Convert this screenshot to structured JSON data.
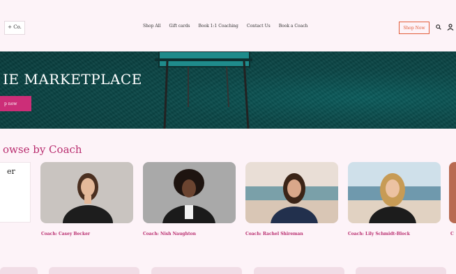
{
  "header": {
    "logo_text": "+ Co.",
    "nav": [
      "Shop All",
      "Gift cards",
      "Book 1:1 Coaching",
      "Contact Us",
      "Book a Coach"
    ],
    "shop_now_label": "Shop Now",
    "accent_color": "#e25d3a",
    "icons": [
      "search-icon",
      "account-icon"
    ]
  },
  "hero": {
    "title": "IE MARKETPLACE",
    "button_label": "p now",
    "button_color": "#cc2e78"
  },
  "browse": {
    "title": "owse by Coach",
    "filter_label": "er",
    "title_color": "#b92d6f",
    "coaches": [
      {
        "name": "Coach: Casey Becker"
      },
      {
        "name": "Coach: Nish Naughton"
      },
      {
        "name": "Coach: Rachel Shireman"
      },
      {
        "name": "Coach: Lily Schmidt-Block"
      }
    ],
    "peek_name": "C"
  }
}
